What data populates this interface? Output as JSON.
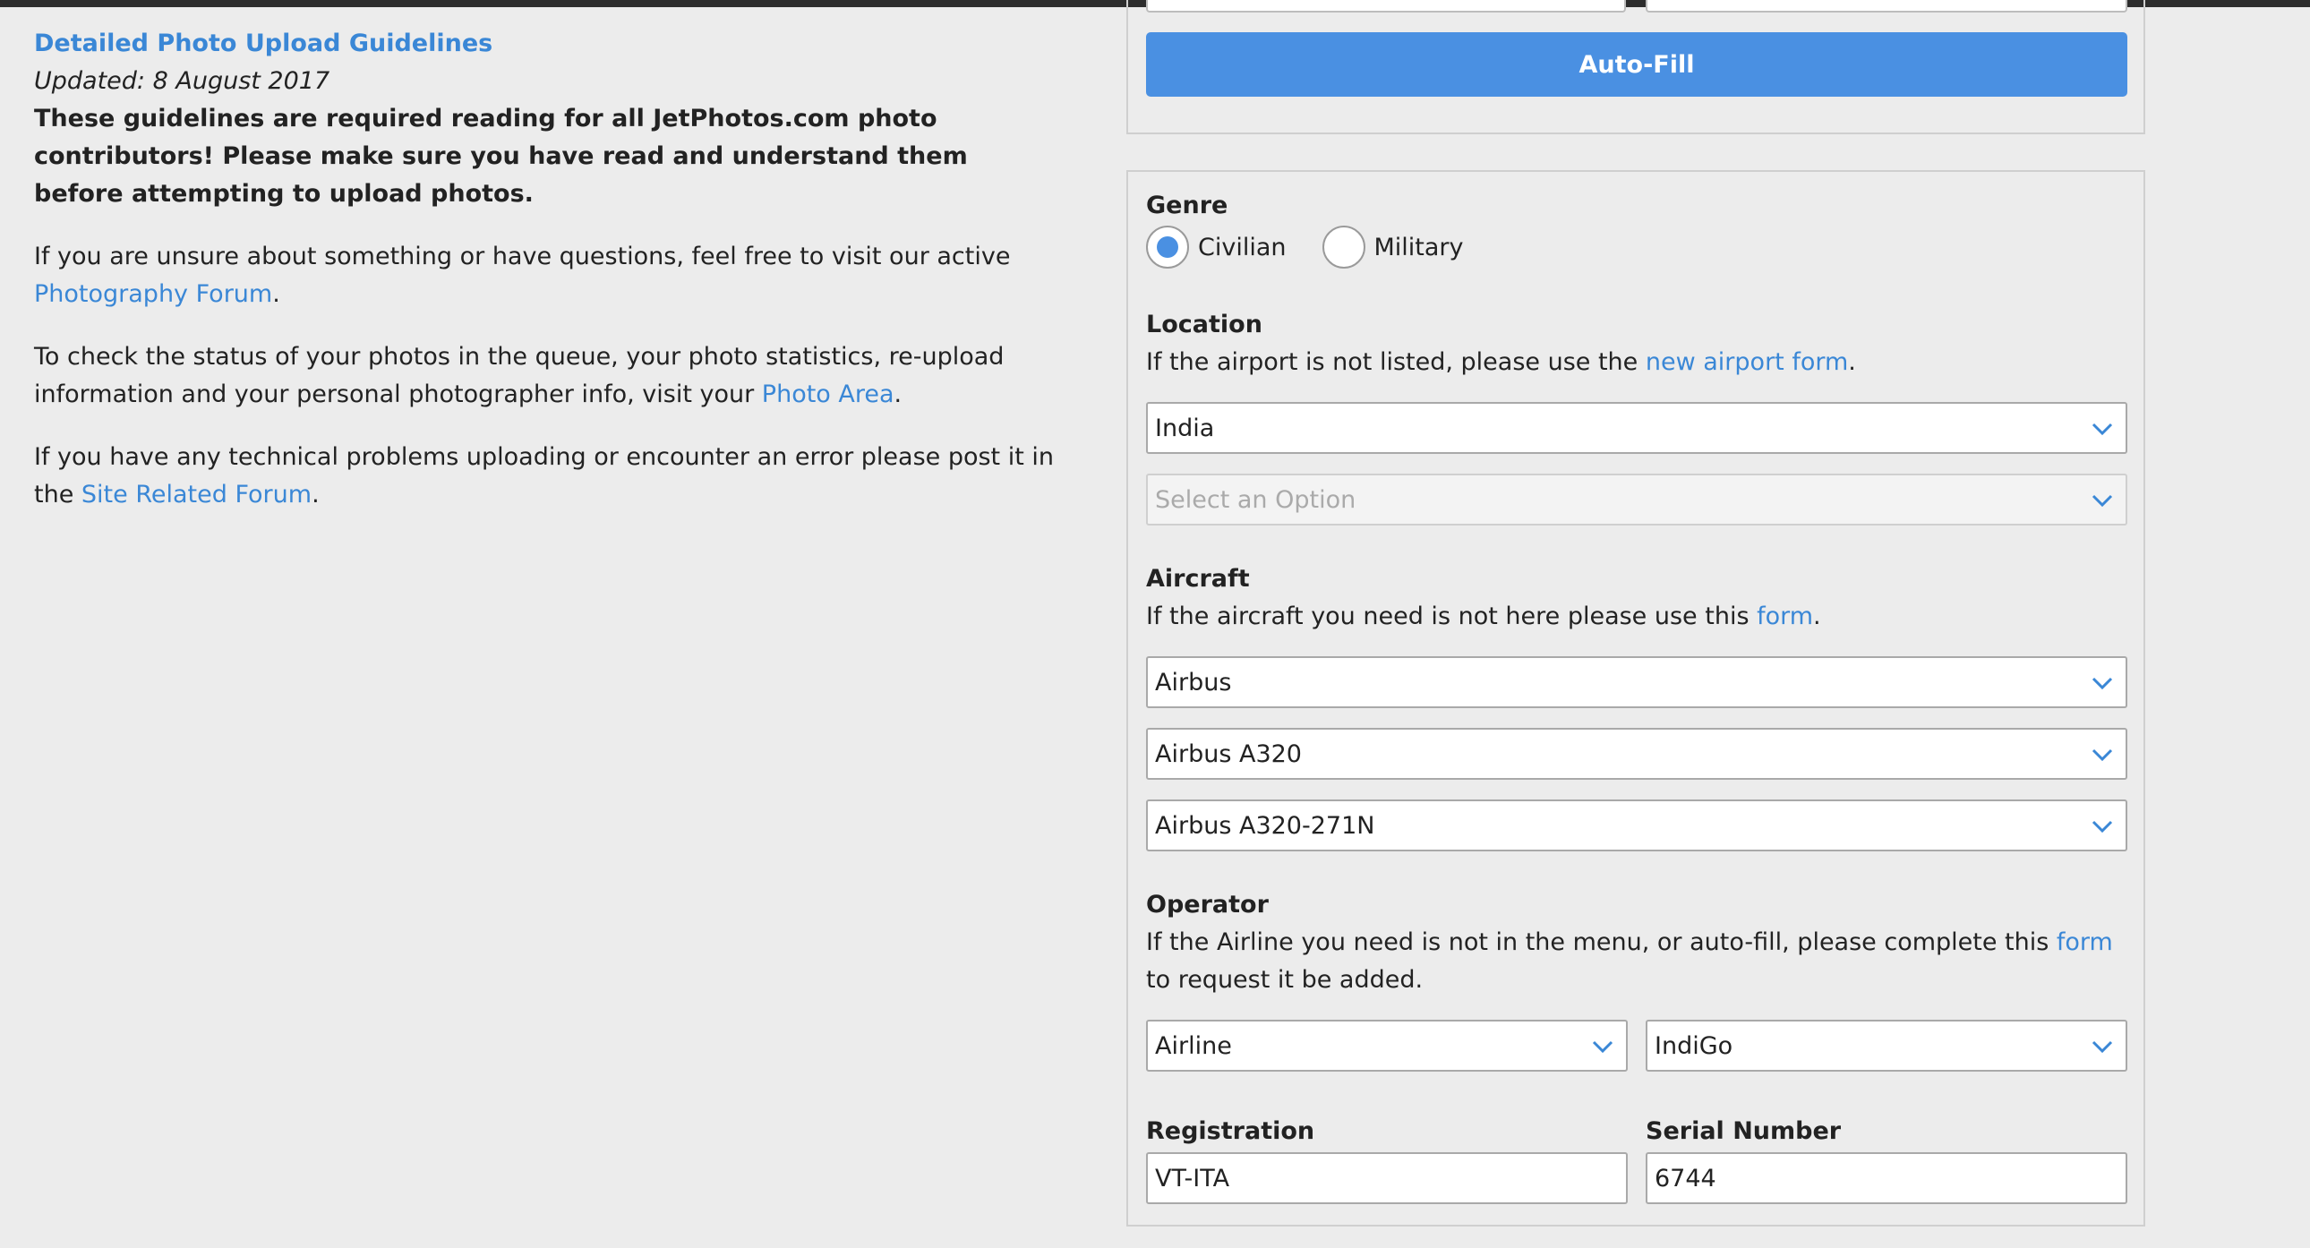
{
  "left": {
    "title": "Detailed Photo Upload Guidelines",
    "updated": "Updated: 8 August 2017",
    "required_notice": "These guidelines are required reading for all JetPhotos.com photo contributors! Please make sure you have read and understand them before attempting to upload photos.",
    "p1_text": "If you are unsure about something or have questions, feel free to visit our active ",
    "p1_link": "Photography Forum",
    "p2_text": "To check the status of your photos in the queue, your photo statistics, re-upload information and your personal photographer info, visit your ",
    "p2_link": "Photo Area",
    "p3_text": "If you have any technical problems uploading or encounter an error please post it in the ",
    "p3_link": "Site Related Forum",
    "period": "."
  },
  "autofill": {
    "button_label": "Auto-Fill"
  },
  "genre": {
    "label": "Genre",
    "options": [
      {
        "label": "Civilian",
        "selected": true
      },
      {
        "label": "Military",
        "selected": false
      }
    ]
  },
  "location": {
    "label": "Location",
    "help_text": "If the airport is not listed, please use the ",
    "help_link": "new airport form",
    "country_value": "India",
    "airport_placeholder": "Select an Option"
  },
  "aircraft": {
    "label": "Aircraft",
    "help_text": "If the aircraft you need is not here please use this ",
    "help_link": "form",
    "manufacturer_value": "Airbus",
    "model_value": "Airbus A320",
    "variant_value": "Airbus A320-271N"
  },
  "operator": {
    "label": "Operator",
    "help_text": "If the Airline you need is not in the menu, or auto-fill, please complete this ",
    "help_link": "form",
    "help_tail": " to request it be added.",
    "type_value": "Airline",
    "name_value": "IndiGo"
  },
  "registration": {
    "label": "Registration",
    "value": "VT-ITA"
  },
  "serial": {
    "label": "Serial Number",
    "value": "6744"
  },
  "colors": {
    "accent": "#4a90e2",
    "link": "#3a87d6",
    "background": "#ececec"
  },
  "icons": {
    "dropdown": "chevron-down-icon"
  }
}
